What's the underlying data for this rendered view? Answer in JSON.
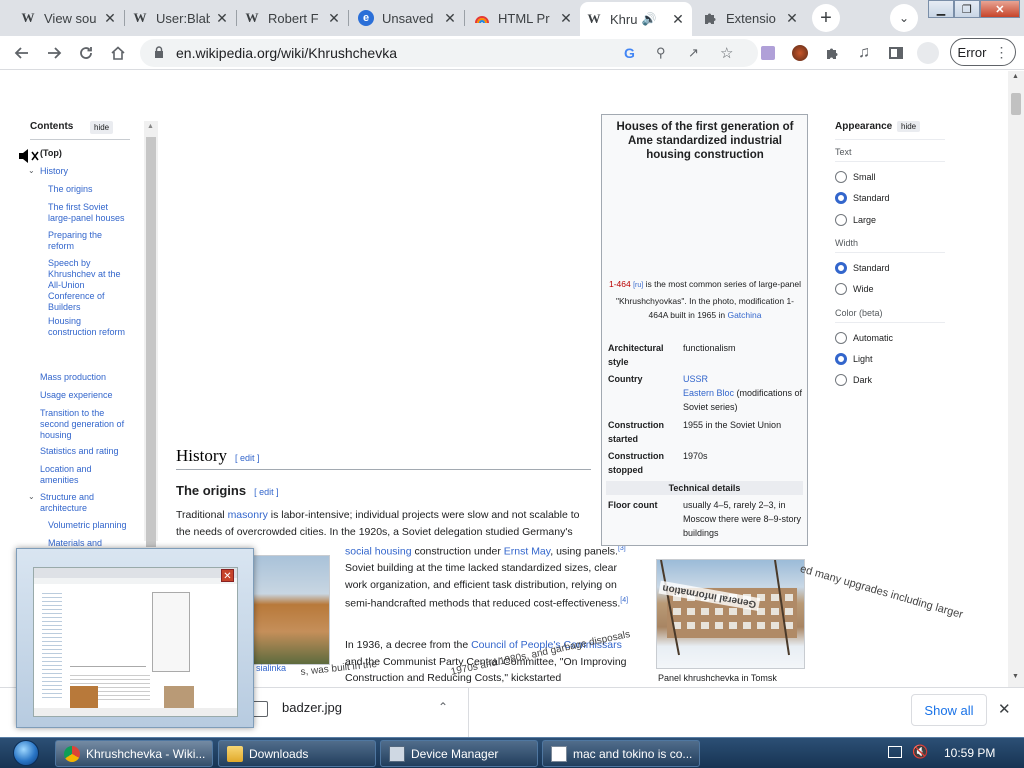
{
  "tabs": [
    {
      "title": "View sou",
      "favicon": "W"
    },
    {
      "title": "User:Blab",
      "favicon": "W"
    },
    {
      "title": "Robert F",
      "favicon": "W"
    },
    {
      "title": "Unsaved",
      "favicon": "e"
    },
    {
      "title": "HTML Pr",
      "favicon": "rainbow"
    },
    {
      "title": "Khru",
      "favicon": "W",
      "active": true
    },
    {
      "title": "Extensio",
      "favicon": "puzzle"
    }
  ],
  "toolbar": {
    "url": "en.wikipedia.org/wiki/Khrushchevka",
    "error_label": "Error"
  },
  "toc": {
    "title": "Contents",
    "hide": "hide",
    "items": [
      "(Top)",
      "History",
      "The origins",
      "The first Soviet large-panel houses",
      "Preparing the reform",
      "Speech by Khrushchev at the All-Union Conference of Builders",
      "Housing construction reform",
      "Mass production",
      "Usage experience",
      "Transition to the second generation of housing",
      "Statistics and rating",
      "Location and amenities",
      "Structure and architecture",
      "Volumetric planning",
      "Materials and"
    ]
  },
  "article": {
    "history_heading": "History",
    "edit": "edit",
    "origins_heading": "The origins",
    "p1_a": "Traditional ",
    "p1_link": "masonry",
    "p1_b": " is labor-intensive; individual projects were slow and not scalable to the needs of overcrowded cities. In the 1920s, a Soviet delegation studied Germany's",
    "p2_link1": "social housing",
    "p2_a": " construction under ",
    "p2_link2": "Ernst May",
    "p2_b": ", using panels.",
    "ref3": "[3]",
    "p2_c": " Soviet building at the time lacked standardized sizes, clear work organization, and efficient task distribution, relying on semi-handcrafted methods that reduced cost-effectiveness.",
    "ref4": "[4]",
    "p3_a": "In 1936, a decree from the ",
    "p3_link": "Council of People's Commissars",
    "p3_b": " and the Communist Party Central Committee, \"On Improving Construction and Reducing Costs,\" kickstarted",
    "photo1_caption": "sialinka",
    "photo2_caption": "Panel khrushchevka in Tomsk",
    "overlay1": "ed many upgrades including larger",
    "overlay2": "1970s and 1980s, and garbage disposals",
    "overlay3": "s, was built in the",
    "overlay4": "General information"
  },
  "infobox": {
    "title": "Houses of the first generation of Ame standardized industrial housing construction",
    "caption_link": "1-464",
    "caption_ru": "[ru]",
    "caption_text": " is the most common series of large-panel \"Khrushchyovkas\". In the photo, modification 1-464A built in 1965 in ",
    "caption_place": "Gatchina",
    "rows": [
      {
        "label": "Architectural style",
        "value": "functionalism"
      },
      {
        "label": "Country",
        "value": "USSR",
        "value2": "Eastern Bloc",
        "value3": " (modifications of Soviet series)"
      },
      {
        "label": "Construction started",
        "value": "1955 in the Soviet Union"
      },
      {
        "label": "Construction stopped",
        "value": "1970s"
      }
    ],
    "section": "Technical details",
    "floor_label": "Floor count",
    "floor_value": "usually 4–5, rarely 2–3, in Moscow there were 8–9-story buildings"
  },
  "appearance": {
    "title": "Appearance",
    "hide": "hide",
    "text_group": "Text",
    "text_options": [
      "Small",
      "Standard",
      "Large"
    ],
    "text_selected": "Standard",
    "width_group": "Width",
    "width_options": [
      "Standard",
      "Wide"
    ],
    "width_selected": "Standard",
    "color_group": "Color (beta)",
    "color_options": [
      "Automatic",
      "Light",
      "Dark"
    ],
    "color_selected": "Light"
  },
  "download": {
    "file": "badzer.jpg",
    "show_all": "Show all"
  },
  "taskbar": {
    "items": [
      "Khrushchevka - Wiki...",
      "Downloads",
      "Device Manager",
      "mac and tokino is co..."
    ],
    "clock": "10:59 PM"
  }
}
